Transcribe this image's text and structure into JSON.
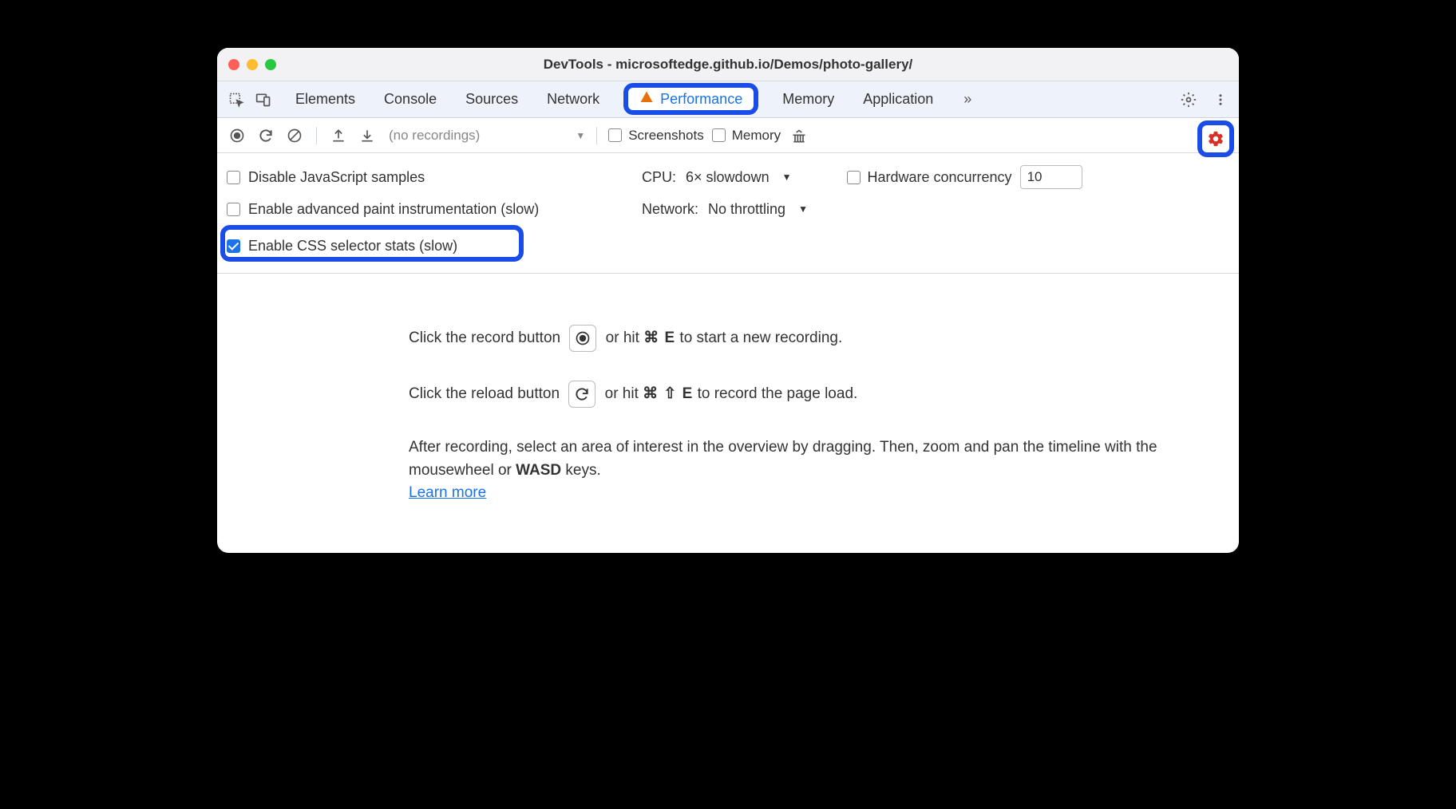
{
  "window": {
    "title": "DevTools - microsoftedge.github.io/Demos/photo-gallery/"
  },
  "tabs": {
    "items": [
      "Elements",
      "Console",
      "Sources",
      "Network",
      "Performance",
      "Memory",
      "Application"
    ],
    "active": "Performance",
    "overflow_glyph": "»"
  },
  "toolbar": {
    "no_recordings": "(no recordings)",
    "screenshots_label": "Screenshots",
    "memory_label": "Memory"
  },
  "settings": {
    "disable_js": "Disable JavaScript samples",
    "cpu_label": "CPU:",
    "cpu_value": "6× slowdown",
    "hw_label": "Hardware concurrency",
    "hw_value": "10",
    "enable_paint": "Enable advanced paint instrumentation (slow)",
    "network_label": "Network:",
    "network_value": "No throttling",
    "enable_css": "Enable CSS selector stats (slow)"
  },
  "help": {
    "line1a": "Click the record button ",
    "line1b": " or hit ",
    "line1_kbd": "⌘ E",
    "line1c": " to start a new recording.",
    "line2a": "Click the reload button ",
    "line2b": " or hit ",
    "line2_kbd": "⌘ ⇧ E",
    "line2c": " to record the page load.",
    "line3a": "After recording, select an area of interest in the overview by dragging. Then, zoom and pan the timeline with the mousewheel or ",
    "line3_wasd": "WASD",
    "line3b": " keys.",
    "learn": "Learn more"
  }
}
